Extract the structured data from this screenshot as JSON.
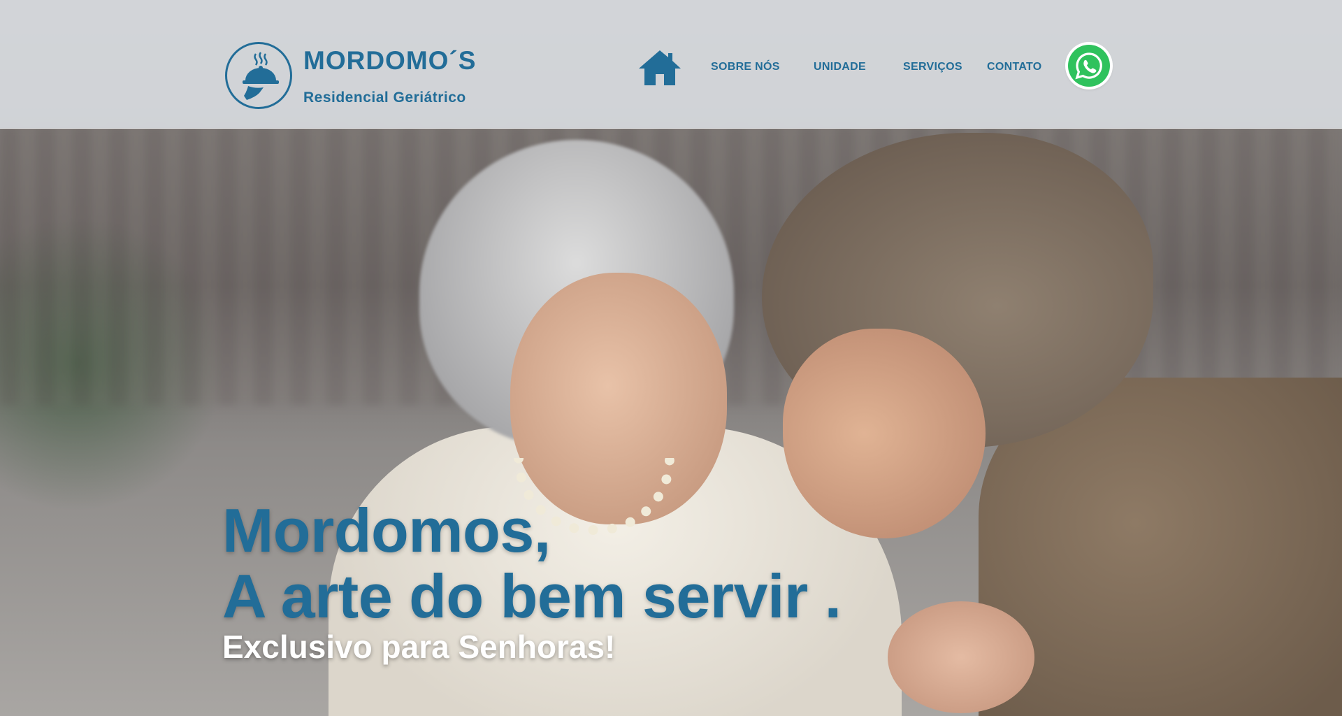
{
  "brand": {
    "name": "MORDOMO´S",
    "subtitle": "Residencial Geriátrico",
    "logo_icon": "cloche-tray-icon"
  },
  "nav": {
    "home_icon": "home-icon",
    "items": [
      {
        "label": "SOBRE NÓS"
      },
      {
        "label": "UNIDADE"
      },
      {
        "label": "SERVIÇOS"
      },
      {
        "label": "CONTATO"
      }
    ],
    "whatsapp_icon": "whatsapp-icon"
  },
  "hero": {
    "headline_line1": "Mordomos,",
    "headline_line2": "A arte do bem servir .",
    "tagline": "Exclusivo para Senhoras!",
    "image": "elderly-woman-with-caregiver-photo"
  },
  "colors": {
    "brand_blue": "#226d98",
    "header_bg": "#dcdfe4",
    "whatsapp_green": "#2fc25d",
    "tagline_text": "#ffffff"
  }
}
